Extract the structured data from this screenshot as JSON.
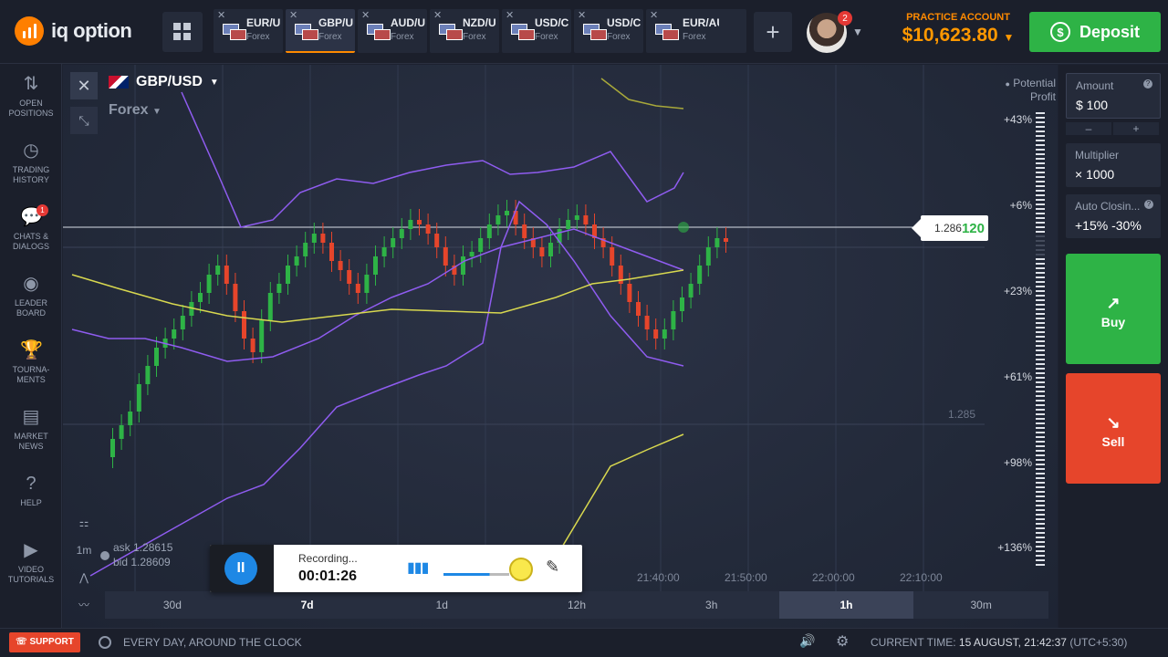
{
  "brand": {
    "name": "iq option"
  },
  "tabs": [
    {
      "name": "EUR/U",
      "category": "Forex",
      "active": false
    },
    {
      "name": "GBP/U",
      "category": "Forex",
      "active": true
    },
    {
      "name": "AUD/U",
      "category": "Forex",
      "active": false
    },
    {
      "name": "NZD/U",
      "category": "Forex",
      "active": false
    },
    {
      "name": "USD/C",
      "category": "Forex",
      "active": false
    },
    {
      "name": "USD/C",
      "category": "Forex",
      "active": false
    },
    {
      "name": "EUR/AUD",
      "category": "Forex",
      "active": false
    }
  ],
  "header": {
    "add_tab": "+",
    "notification_count": "2",
    "account_label": "PRACTICE ACCOUNT",
    "balance": "$10,623.80",
    "deposit_label": "Deposit"
  },
  "sidebar": {
    "items": [
      {
        "label_1": "OPEN",
        "label_2": "POSITIONS",
        "icon": "arrows-updown-icon"
      },
      {
        "label_1": "TRADING",
        "label_2": "HISTORY",
        "icon": "history-icon"
      },
      {
        "label_1": "CHATS &",
        "label_2": "DIALOGS",
        "icon": "chat-icon",
        "badge": "1"
      },
      {
        "label_1": "LEADER",
        "label_2": "BOARD",
        "icon": "leaderboard-icon"
      },
      {
        "label_1": "TOURNA-",
        "label_2": "MENTS",
        "icon": "trophy-icon"
      },
      {
        "label_1": "MARKET",
        "label_2": "NEWS",
        "icon": "news-icon"
      },
      {
        "label_1": "HELP",
        "label_2": "",
        "icon": "help-icon"
      },
      {
        "label_1": "VIDEO",
        "label_2": "TUTORIALS",
        "icon": "video-icon"
      }
    ]
  },
  "chart": {
    "asset": "GBP/USD",
    "category": "Forex",
    "potential_profit_1": "Potential",
    "potential_profit_2": "Profit",
    "current_price_prefix": "1.286",
    "current_price_suffix": "120",
    "price_level": "1.285",
    "ask": "ask 1.28615",
    "bid": "bid 1.28609",
    "timeframe": "1m",
    "profit_levels": [
      "+43%",
      "+6%",
      "+23%",
      "+61%",
      "+98%",
      "+136%"
    ],
    "time_labels": [
      "21:40:00",
      "21:50:00",
      "22:00:00",
      "22:10:00"
    ],
    "periods": [
      "30d",
      "7d",
      "1d",
      "12h",
      "3h",
      "1h",
      "30m"
    ],
    "active_period": "1h"
  },
  "chart_data": {
    "type": "candlestick",
    "series": [
      {
        "name": "GBP/USD",
        "note": "candles rendered approximately"
      }
    ],
    "indicators": [
      "bollinger-bands",
      "moving-average"
    ]
  },
  "trade_panel": {
    "amount_label": "Amount",
    "amount_value": "$ 100",
    "minus": "–",
    "plus": "+",
    "multiplier_label": "Multiplier",
    "multiplier_value": "× 1000",
    "autoclose_label": "Auto Closin...",
    "autoclose_value": "+15% -30%",
    "buy_label": "Buy",
    "sell_label": "Sell"
  },
  "recorder": {
    "status": "Recording...",
    "elapsed": "00:01:26"
  },
  "footer": {
    "support_label": "SUPPORT",
    "tagline": "EVERY DAY, AROUND THE CLOCK",
    "current_time_label": "CURRENT TIME:",
    "current_time_value": "15 AUGUST, 21:42:37",
    "timezone": "(UTC+5:30)"
  }
}
